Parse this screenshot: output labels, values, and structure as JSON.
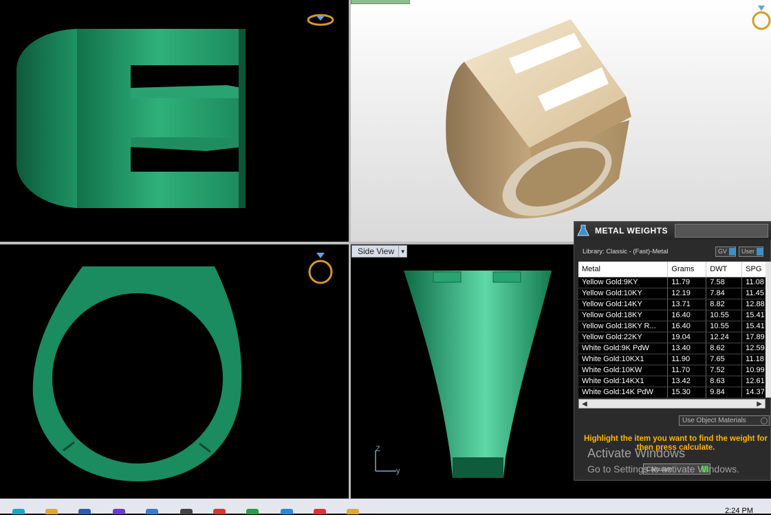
{
  "viewports": {
    "perspective_label": "",
    "side_view_label": "Side View"
  },
  "axis": {
    "z": "Z",
    "y": "y"
  },
  "panel": {
    "title": "METAL WEIGHTS",
    "library": "Library: Classic - (Fast)-Metal",
    "gv_label": "GV",
    "user_label": "User",
    "columns": [
      "Metal",
      "Grams",
      "DWT",
      "SPG"
    ],
    "rows": [
      [
        "Yellow Gold:9KY",
        "11.79",
        "7.58",
        "11.08"
      ],
      [
        "Yellow Gold:10KY",
        "12.19",
        "7.84",
        "11.45"
      ],
      [
        "Yellow Gold:14KY",
        "13.71",
        "8.82",
        "12.88"
      ],
      [
        "Yellow Gold:18KY",
        "16.40",
        "10.55",
        "15.41"
      ],
      [
        "Yellow Gold:18KY R...",
        "16.40",
        "10.55",
        "15.41"
      ],
      [
        "Yellow Gold:22KY",
        "19.04",
        "12.24",
        "17.89"
      ],
      [
        "White Gold:9K PdW",
        "13.40",
        "8.62",
        "12.59"
      ],
      [
        "White Gold:10KX1",
        "11.90",
        "7.65",
        "11.18"
      ],
      [
        "White Gold:10KW",
        "11.70",
        "7.52",
        "10.99"
      ],
      [
        "White Gold:14KX1",
        "13.42",
        "8.63",
        "12.61"
      ],
      [
        "White Gold:14K PdW",
        "15.30",
        "9.84",
        "14.37"
      ]
    ],
    "use_object_materials": "Use Object Materials",
    "highlight_text": "Highlight the item you want to find the weight for then press calculate.",
    "calculate_label": "Calculate"
  },
  "watermark": {
    "line1": "Activate Windows",
    "line2": "Go to Settings to activate Windows."
  },
  "taskbar": {
    "clock": "2:24 PM"
  }
}
